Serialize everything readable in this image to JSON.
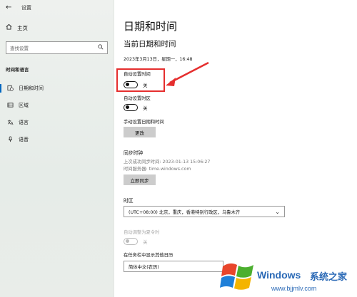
{
  "window": {
    "title": "设置",
    "back_glyph": "←"
  },
  "sidebar": {
    "home_label": "主页",
    "search_placeholder": "查找设置",
    "section_title": "时间和语言",
    "items": [
      {
        "label": "日期和时间",
        "icon": "calendar-clock-icon",
        "active": true
      },
      {
        "label": "区域",
        "icon": "region-icon",
        "active": false
      },
      {
        "label": "语言",
        "icon": "language-icon",
        "active": false
      },
      {
        "label": "语音",
        "icon": "microphone-icon",
        "active": false
      }
    ]
  },
  "main": {
    "page_title": "日期和时间",
    "current_heading": "当前日期和时间",
    "current_datetime": "2023年3月13日，星期一，16:48",
    "auto_time": {
      "label": "自动设置时间",
      "state_label": "关",
      "on": false
    },
    "auto_timezone": {
      "label": "自动设置时区",
      "state_label": "关",
      "on": false
    },
    "manual": {
      "label": "手动设置日期和时间",
      "button": "更改"
    },
    "sync": {
      "heading": "同步时钟",
      "last_sync": "上次成功同步时间: 2023-01-13 15:06:27",
      "server": "时间服务器: time.windows.com",
      "button": "立即同步"
    },
    "timezone": {
      "label": "时区",
      "value": "(UTC+08:00) 北京，重庆，香港特别行政区，乌鲁木齐"
    },
    "dst": {
      "label": "自动调整为夏令时",
      "state_label": "关",
      "on": false,
      "disabled": true
    },
    "calendar": {
      "label": "在任务栏中显示其他日历",
      "value": "简体中文(农历)"
    }
  },
  "watermark": {
    "brand": "Windows",
    "suffix": "系统之家",
    "url": "www.bjjmlv.com"
  },
  "colors": {
    "accent": "#0067c0",
    "highlight": "#e52e2e",
    "watermark": "#2a69b6"
  }
}
